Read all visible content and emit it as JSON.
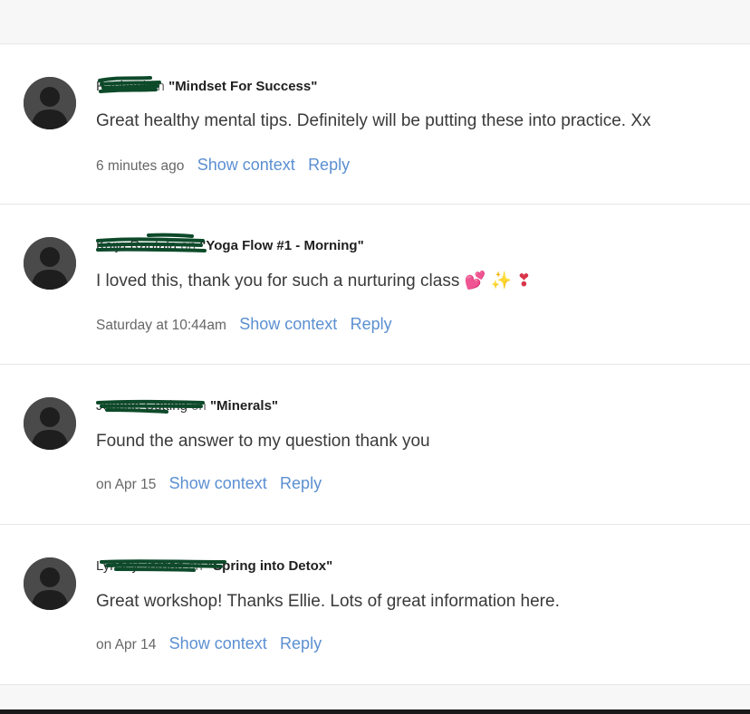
{
  "comments": [
    {
      "author": "Rachael",
      "on_word": "on",
      "lesson": "\"Mindset For Success\"",
      "body": "Great healthy mental tips. Definitely will be putting these into practice. Xx",
      "time": "6 minutes ago",
      "show_context": "Show context",
      "reply": "Reply"
    },
    {
      "author": "Kaija Rantala",
      "on_word": "on",
      "lesson": "\"Yoga Flow #1 - Morning\"",
      "body": "I loved this, thank you for such a nurturing class",
      "emojis": [
        "💕",
        "✨",
        "❣"
      ],
      "time": "Saturday at 10:44am",
      "show_context": "Show context",
      "reply": "Reply"
    },
    {
      "author": "Joanne Cutting",
      "on_word": "on",
      "lesson": "\"Minerals\"",
      "body": "Found the answer to my question thank you",
      "time": "on Apr 15",
      "show_context": "Show context",
      "reply": "Reply"
    },
    {
      "author": "Lynsey Jordan",
      "on_word": "on",
      "lesson": "\"Spring into Detox\"",
      "body": "Great workshop! Thanks Ellie. Lots of great information here.",
      "time": "on Apr 14",
      "show_context": "Show context",
      "reply": "Reply"
    }
  ],
  "colors": {
    "link": "#5b8fd1",
    "redaction": "#0d4a2a",
    "avatar": "#4a4a4a"
  }
}
